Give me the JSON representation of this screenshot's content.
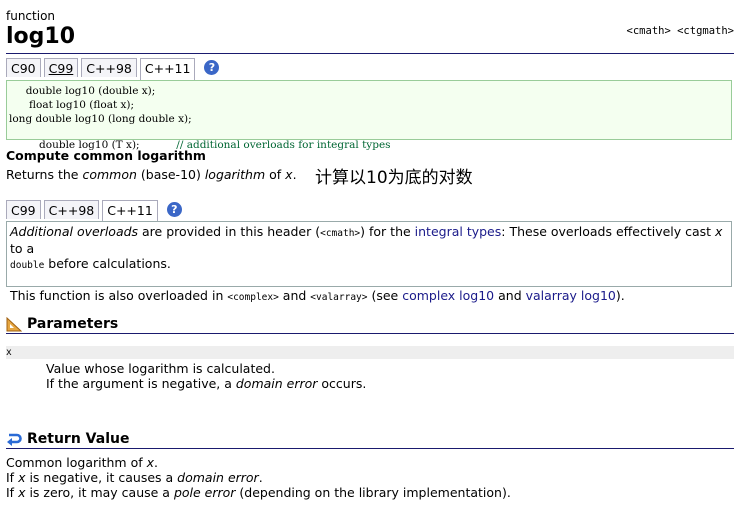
{
  "page": {
    "kind": "function",
    "title": "log10",
    "headers": "<cmath> <ctgmath>"
  },
  "version_tabs": [
    "C90",
    "C99",
    "C++98",
    "C++11"
  ],
  "help_icon": "?",
  "code": {
    "lines": [
      "     double log10 (double x);",
      "      float log10 (float x);",
      "long double log10 (long double x);",
      "     double log10 (T x);           "
    ],
    "comment": "// additional overloads for integral types"
  },
  "summary": {
    "heading": "Compute common logarithm",
    "desc_1": "Returns the ",
    "desc_common": "common",
    "desc_2": " (base-10) ",
    "desc_log": "logarithm",
    "desc_3": " of ",
    "desc_x": "x",
    "desc_4": ".",
    "annotation": "计算以10为底的对数"
  },
  "version_tabs_2": [
    "C99",
    "C++98",
    "C++11"
  ],
  "note": {
    "p1_italic": "Additional overloads",
    "p1_a": " are provided in this header (",
    "p1_code1": "<cmath>",
    "p1_b": ") for the ",
    "p1_link": "integral types",
    "p1_c": ": These overloads effectively cast ",
    "p1_x": "x",
    "p1_d": " to a",
    "p1_code2": "double",
    "p1_e": " before calculations.",
    "p2_a": "This function is also overloaded in ",
    "p2_code1": "<complex>",
    "p2_b": " and ",
    "p2_code2": "<valarray>",
    "p2_c": " (see ",
    "p2_link1": "complex log10",
    "p2_d": " and ",
    "p2_link2": "valarray log10",
    "p2_e": ")."
  },
  "parameters": {
    "heading": "Parameters",
    "name": "x",
    "line1": "Value whose logarithm is calculated.",
    "line2_a": "If the argument is negative, a ",
    "line2_i": "domain error",
    "line2_b": " occurs."
  },
  "return_value": {
    "heading": "Return Value",
    "l1_a": "Common logarithm of ",
    "l1_x": "x",
    "l1_b": ".",
    "l2_a": "If ",
    "l2_x": "x",
    "l2_b": " is negative, it causes a ",
    "l2_i": "domain error",
    "l2_c": ".",
    "l3_a": "If ",
    "l3_x": "x",
    "l3_b": " is zero, it may cause a ",
    "l3_i": "pole error",
    "l3_c": " (depending on the library implementation)."
  },
  "colors": {
    "rule": "#1a1a6e",
    "link": "#1a1a8a",
    "code_bg": "#f4fff0",
    "help": "#3b67c7"
  }
}
